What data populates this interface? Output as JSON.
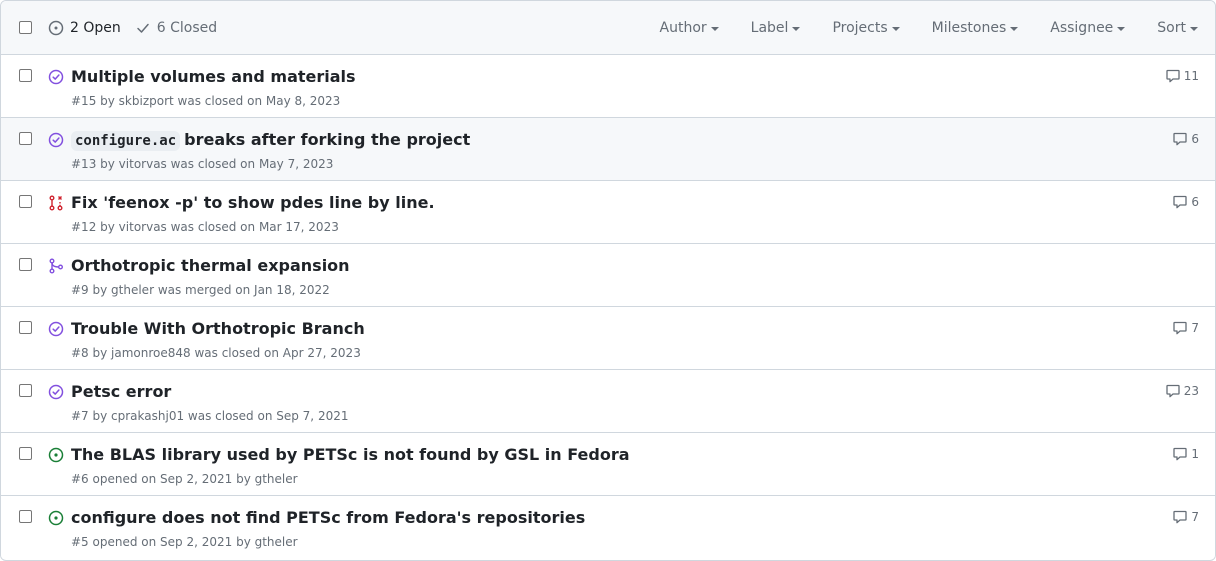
{
  "toolbar": {
    "open_count": "2 Open",
    "closed_count": "6 Closed",
    "filters": [
      {
        "label": "Author",
        "name": "author"
      },
      {
        "label": "Label",
        "name": "label"
      },
      {
        "label": "Projects",
        "name": "projects"
      },
      {
        "label": "Milestones",
        "name": "milestones"
      },
      {
        "label": "Assignee",
        "name": "assignee"
      },
      {
        "label": "Sort",
        "name": "sort"
      }
    ]
  },
  "issues": [
    {
      "code": "",
      "title": "Multiple volumes and materials",
      "meta": "#15 by skbizport was closed on May 8, 2023",
      "state": "closed",
      "comments": "11"
    },
    {
      "code": "configure.ac",
      "title": "breaks after forking the project",
      "meta": "#13 by vitorvas was closed on May 7, 2023",
      "state": "closed",
      "comments": "6"
    },
    {
      "code": "",
      "title": "Fix 'feenox -p' to show pdes line by line.",
      "meta": "#12 by vitorvas was closed on Mar 17, 2023",
      "state": "pr-closed",
      "comments": "6"
    },
    {
      "code": "",
      "title": "Orthotropic thermal expansion",
      "meta": "#9 by gtheler was merged on Jan 18, 2022",
      "state": "pr-merged",
      "comments": ""
    },
    {
      "code": "",
      "title": "Trouble With Orthotropic Branch",
      "meta": "#8 by jamonroe848 was closed on Apr 27, 2023",
      "state": "closed",
      "comments": "7"
    },
    {
      "code": "",
      "title": "Petsc error",
      "meta": "#7 by cprakashj01 was closed on Sep 7, 2021",
      "state": "closed",
      "comments": "23"
    },
    {
      "code": "",
      "title": "The BLAS library used by PETSc is not found by GSL in Fedora",
      "meta": "#6 opened on Sep 2, 2021 by gtheler",
      "state": "open",
      "comments": "1"
    },
    {
      "code": "",
      "title": "configure does not find PETSc from Fedora's repositories",
      "meta": "#5 opened on Sep 2, 2021 by gtheler",
      "state": "open",
      "comments": "7"
    }
  ],
  "colors": {
    "open": "#1a7f37",
    "closed": "#8250df",
    "pr_closed": "#cf222e",
    "merged": "#8250df",
    "muted": "#656d76"
  },
  "icons": {
    "open_filter": "issue-opened-icon",
    "closed_filter": "check-icon",
    "comment": "comment-icon"
  }
}
